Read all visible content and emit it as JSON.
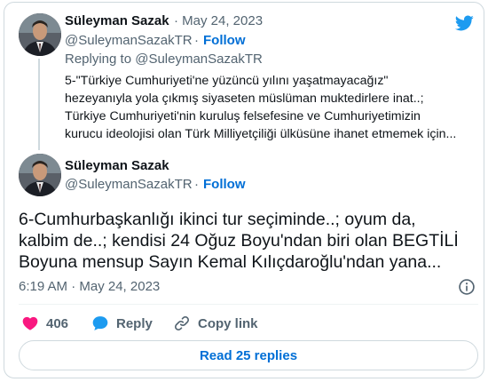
{
  "colors": {
    "accent": "#006fd6",
    "twitter_blue": "#1d9bf0",
    "heart": "#f91880",
    "secondary_text": "#536471"
  },
  "parent_tweet": {
    "author_name": "Süleyman Sazak",
    "date": "· May 24, 2023",
    "handle": "@SuleymanSazakTR",
    "separator": "·",
    "follow_label": "Follow",
    "reply_to": "Replying to @SuleymanSazakTR",
    "text_lines": [
      "5-\"Türkiye Cumhuriyeti'ne yüzüncü yılını yaşatmayacağız\"",
      "hezeyanıyla yola çıkmış siyaseten müslüman muktedirlere inat..;",
      "Türkiye Cumhuriyeti'nin kuruluş felsefesine ve Cumhuriyetimizin",
      "kurucu ideolojisi olan Türk Milliyetçiliği  ülküsüne ihanet etmemek için..."
    ]
  },
  "main_tweet": {
    "author_name": "Süleyman Sazak",
    "handle": "@SuleymanSazakTR",
    "separator": "·",
    "follow_label": "Follow",
    "text_lines": [
      "6-Cumhurbaşkanlığı ikinci tur seçiminde..; oyum da,",
      "kalbim de..; kendisi 24 Oğuz Boyu'ndan biri olan  BEGTİLİ",
      "Boyuna mensup Sayın Kemal Kılıçdaroğlu'ndan yana..."
    ],
    "timestamp": "6:19 AM · May 24, 2023"
  },
  "actions": {
    "like_count": "406",
    "reply_label": "Reply",
    "copy_link_label": "Copy link"
  },
  "read_replies_label": "Read 25 replies",
  "icons": {
    "logo": "twitter-bird-icon",
    "info": "info-icon",
    "like": "heart-icon",
    "reply": "speech-bubble-icon",
    "copy": "link-icon"
  }
}
